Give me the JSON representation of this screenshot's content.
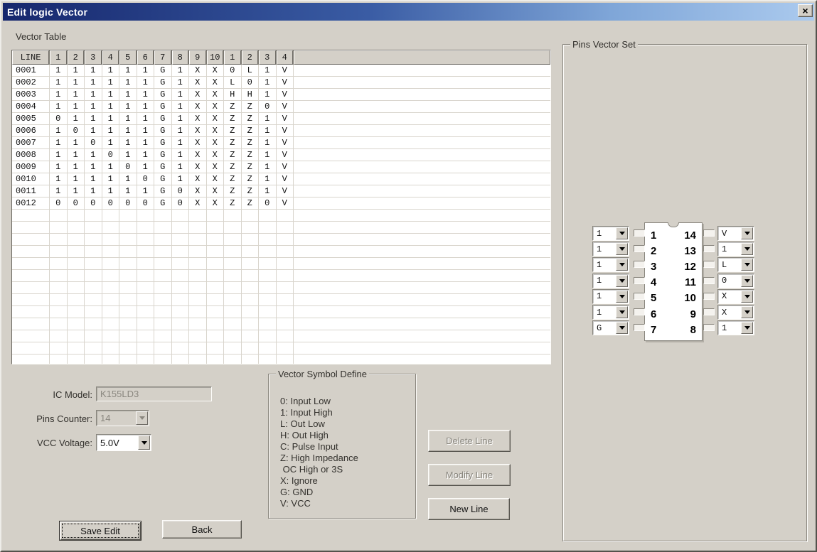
{
  "window": {
    "title": "Edit logic Vector"
  },
  "icons": {
    "close": "×",
    "dropdown_arrow": "▼ (css triangle)"
  },
  "colors": {
    "dialog_bg": "#d4d0c8",
    "titlebar_gradient_start": "#16276d",
    "titlebar_gradient_end": "#abcaee",
    "grid_line": "#d9d5cd",
    "disabled_text": "#8a877f"
  },
  "vector_table": {
    "label": "Vector Table",
    "columns": [
      "LINE",
      "1",
      "2",
      "3",
      "4",
      "5",
      "6",
      "7",
      "8",
      "9",
      "10",
      "1",
      "2",
      "3",
      "4"
    ],
    "rows": [
      {
        "line": "0001",
        "values": [
          "1",
          "1",
          "1",
          "1",
          "1",
          "1",
          "G",
          "1",
          "X",
          "X",
          "0",
          "L",
          "1",
          "V"
        ]
      },
      {
        "line": "0002",
        "values": [
          "1",
          "1",
          "1",
          "1",
          "1",
          "1",
          "G",
          "1",
          "X",
          "X",
          "L",
          "0",
          "1",
          "V"
        ]
      },
      {
        "line": "0003",
        "values": [
          "1",
          "1",
          "1",
          "1",
          "1",
          "1",
          "G",
          "1",
          "X",
          "X",
          "H",
          "H",
          "1",
          "V"
        ]
      },
      {
        "line": "0004",
        "values": [
          "1",
          "1",
          "1",
          "1",
          "1",
          "1",
          "G",
          "1",
          "X",
          "X",
          "Z",
          "Z",
          "0",
          "V"
        ]
      },
      {
        "line": "0005",
        "values": [
          "0",
          "1",
          "1",
          "1",
          "1",
          "1",
          "G",
          "1",
          "X",
          "X",
          "Z",
          "Z",
          "1",
          "V"
        ]
      },
      {
        "line": "0006",
        "values": [
          "1",
          "0",
          "1",
          "1",
          "1",
          "1",
          "G",
          "1",
          "X",
          "X",
          "Z",
          "Z",
          "1",
          "V"
        ]
      },
      {
        "line": "0007",
        "values": [
          "1",
          "1",
          "0",
          "1",
          "1",
          "1",
          "G",
          "1",
          "X",
          "X",
          "Z",
          "Z",
          "1",
          "V"
        ]
      },
      {
        "line": "0008",
        "values": [
          "1",
          "1",
          "1",
          "0",
          "1",
          "1",
          "G",
          "1",
          "X",
          "X",
          "Z",
          "Z",
          "1",
          "V"
        ]
      },
      {
        "line": "0009",
        "values": [
          "1",
          "1",
          "1",
          "1",
          "0",
          "1",
          "G",
          "1",
          "X",
          "X",
          "Z",
          "Z",
          "1",
          "V"
        ]
      },
      {
        "line": "0010",
        "values": [
          "1",
          "1",
          "1",
          "1",
          "1",
          "0",
          "G",
          "1",
          "X",
          "X",
          "Z",
          "Z",
          "1",
          "V"
        ]
      },
      {
        "line": "0011",
        "values": [
          "1",
          "1",
          "1",
          "1",
          "1",
          "1",
          "G",
          "0",
          "X",
          "X",
          "Z",
          "Z",
          "1",
          "V"
        ]
      },
      {
        "line": "0012",
        "values": [
          "0",
          "0",
          "0",
          "0",
          "0",
          "0",
          "G",
          "0",
          "X",
          "X",
          "Z",
          "Z",
          "0",
          "V"
        ]
      }
    ]
  },
  "form": {
    "ic_model_label": "IC Model:",
    "ic_model_value": "K155LD3",
    "pins_counter_label": "Pins Counter:",
    "pins_counter_value": "14",
    "vcc_voltage_label": "VCC Voltage:",
    "vcc_voltage_value": "5.0V"
  },
  "symbol_define": {
    "title": "Vector Symbol Define",
    "lines": [
      "0: Input Low",
      "1: Input High",
      "L: Out Low",
      "H: Out High",
      "C: Pulse Input",
      "Z: High Impedance",
      " OC High or 3S",
      "X: Ignore",
      "G: GND",
      "V: VCC"
    ]
  },
  "buttons": {
    "delete_line": "Delete Line",
    "modify_line": "Modify Line",
    "new_line": "New Line",
    "save_edit": "Save Edit",
    "back": "Back"
  },
  "pins_vector_set": {
    "title": "Pins Vector Set",
    "rows": [
      {
        "left_pin": "1",
        "left_value": "1",
        "right_pin": "14",
        "right_value": "V"
      },
      {
        "left_pin": "2",
        "left_value": "1",
        "right_pin": "13",
        "right_value": "1"
      },
      {
        "left_pin": "3",
        "left_value": "1",
        "right_pin": "12",
        "right_value": "L"
      },
      {
        "left_pin": "4",
        "left_value": "1",
        "right_pin": "11",
        "right_value": "0"
      },
      {
        "left_pin": "5",
        "left_value": "1",
        "right_pin": "10",
        "right_value": "X"
      },
      {
        "left_pin": "6",
        "left_value": "1",
        "right_pin": "9",
        "right_value": "X"
      },
      {
        "left_pin": "7",
        "left_value": "G",
        "right_pin": "8",
        "right_value": "1"
      }
    ]
  }
}
